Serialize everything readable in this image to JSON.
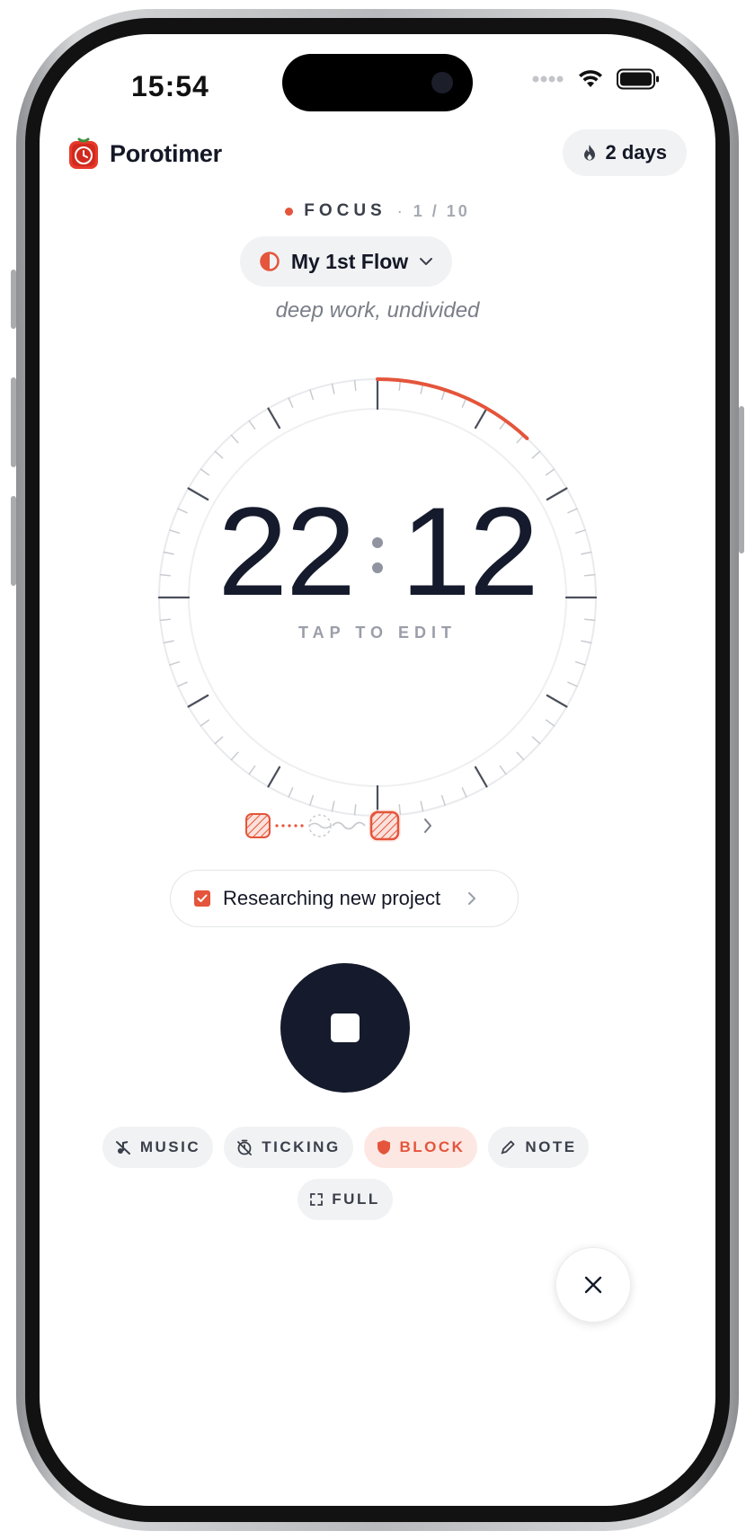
{
  "status_bar": {
    "time": "15:54"
  },
  "header": {
    "app_name": "Porotimer",
    "streak_label": "2 days"
  },
  "session": {
    "mode": "FOCUS",
    "separator": "·",
    "count": "1 / 10"
  },
  "flow": {
    "name": "My 1st Flow"
  },
  "tagline": "deep work, undivided",
  "timer": {
    "minutes": "22",
    "seconds": "12",
    "hint": "TAP TO EDIT",
    "elapsed_fraction": 0.12
  },
  "task": {
    "label": "Researching new project"
  },
  "chips": {
    "music": "MUSIC",
    "ticking": "TICKING",
    "block": "BLOCK",
    "note": "NOTE",
    "full": "FULL"
  },
  "colors": {
    "accent": "#e4553b",
    "ink": "#151b2c",
    "chip_bg": "#f1f2f4"
  }
}
